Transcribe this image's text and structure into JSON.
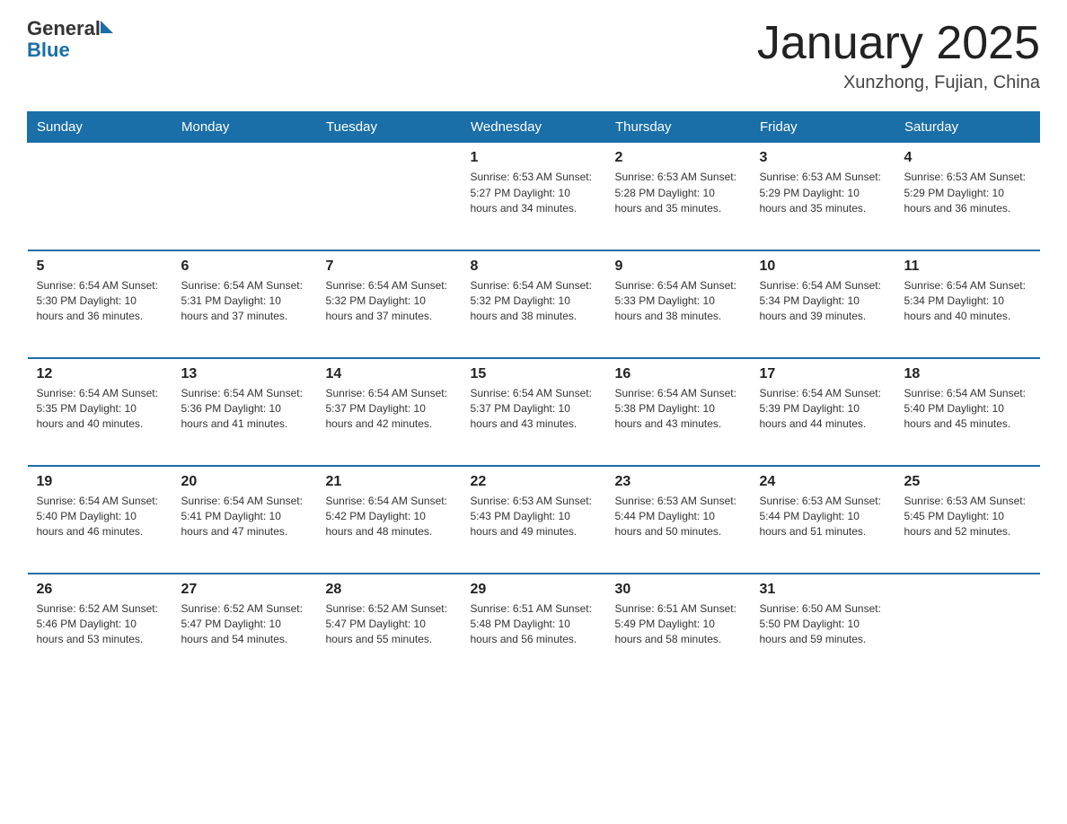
{
  "header": {
    "logo_general": "General",
    "logo_blue": "Blue",
    "title": "January 2025",
    "location": "Xunzhong, Fujian, China"
  },
  "days_of_week": [
    "Sunday",
    "Monday",
    "Tuesday",
    "Wednesday",
    "Thursday",
    "Friday",
    "Saturday"
  ],
  "weeks": [
    {
      "cells": [
        {
          "day": "",
          "info": ""
        },
        {
          "day": "",
          "info": ""
        },
        {
          "day": "",
          "info": ""
        },
        {
          "day": "1",
          "info": "Sunrise: 6:53 AM\nSunset: 5:27 PM\nDaylight: 10 hours\nand 34 minutes."
        },
        {
          "day": "2",
          "info": "Sunrise: 6:53 AM\nSunset: 5:28 PM\nDaylight: 10 hours\nand 35 minutes."
        },
        {
          "day": "3",
          "info": "Sunrise: 6:53 AM\nSunset: 5:29 PM\nDaylight: 10 hours\nand 35 minutes."
        },
        {
          "day": "4",
          "info": "Sunrise: 6:53 AM\nSunset: 5:29 PM\nDaylight: 10 hours\nand 36 minutes."
        }
      ]
    },
    {
      "cells": [
        {
          "day": "5",
          "info": "Sunrise: 6:54 AM\nSunset: 5:30 PM\nDaylight: 10 hours\nand 36 minutes."
        },
        {
          "day": "6",
          "info": "Sunrise: 6:54 AM\nSunset: 5:31 PM\nDaylight: 10 hours\nand 37 minutes."
        },
        {
          "day": "7",
          "info": "Sunrise: 6:54 AM\nSunset: 5:32 PM\nDaylight: 10 hours\nand 37 minutes."
        },
        {
          "day": "8",
          "info": "Sunrise: 6:54 AM\nSunset: 5:32 PM\nDaylight: 10 hours\nand 38 minutes."
        },
        {
          "day": "9",
          "info": "Sunrise: 6:54 AM\nSunset: 5:33 PM\nDaylight: 10 hours\nand 38 minutes."
        },
        {
          "day": "10",
          "info": "Sunrise: 6:54 AM\nSunset: 5:34 PM\nDaylight: 10 hours\nand 39 minutes."
        },
        {
          "day": "11",
          "info": "Sunrise: 6:54 AM\nSunset: 5:34 PM\nDaylight: 10 hours\nand 40 minutes."
        }
      ]
    },
    {
      "cells": [
        {
          "day": "12",
          "info": "Sunrise: 6:54 AM\nSunset: 5:35 PM\nDaylight: 10 hours\nand 40 minutes."
        },
        {
          "day": "13",
          "info": "Sunrise: 6:54 AM\nSunset: 5:36 PM\nDaylight: 10 hours\nand 41 minutes."
        },
        {
          "day": "14",
          "info": "Sunrise: 6:54 AM\nSunset: 5:37 PM\nDaylight: 10 hours\nand 42 minutes."
        },
        {
          "day": "15",
          "info": "Sunrise: 6:54 AM\nSunset: 5:37 PM\nDaylight: 10 hours\nand 43 minutes."
        },
        {
          "day": "16",
          "info": "Sunrise: 6:54 AM\nSunset: 5:38 PM\nDaylight: 10 hours\nand 43 minutes."
        },
        {
          "day": "17",
          "info": "Sunrise: 6:54 AM\nSunset: 5:39 PM\nDaylight: 10 hours\nand 44 minutes."
        },
        {
          "day": "18",
          "info": "Sunrise: 6:54 AM\nSunset: 5:40 PM\nDaylight: 10 hours\nand 45 minutes."
        }
      ]
    },
    {
      "cells": [
        {
          "day": "19",
          "info": "Sunrise: 6:54 AM\nSunset: 5:40 PM\nDaylight: 10 hours\nand 46 minutes."
        },
        {
          "day": "20",
          "info": "Sunrise: 6:54 AM\nSunset: 5:41 PM\nDaylight: 10 hours\nand 47 minutes."
        },
        {
          "day": "21",
          "info": "Sunrise: 6:54 AM\nSunset: 5:42 PM\nDaylight: 10 hours\nand 48 minutes."
        },
        {
          "day": "22",
          "info": "Sunrise: 6:53 AM\nSunset: 5:43 PM\nDaylight: 10 hours\nand 49 minutes."
        },
        {
          "day": "23",
          "info": "Sunrise: 6:53 AM\nSunset: 5:44 PM\nDaylight: 10 hours\nand 50 minutes."
        },
        {
          "day": "24",
          "info": "Sunrise: 6:53 AM\nSunset: 5:44 PM\nDaylight: 10 hours\nand 51 minutes."
        },
        {
          "day": "25",
          "info": "Sunrise: 6:53 AM\nSunset: 5:45 PM\nDaylight: 10 hours\nand 52 minutes."
        }
      ]
    },
    {
      "cells": [
        {
          "day": "26",
          "info": "Sunrise: 6:52 AM\nSunset: 5:46 PM\nDaylight: 10 hours\nand 53 minutes."
        },
        {
          "day": "27",
          "info": "Sunrise: 6:52 AM\nSunset: 5:47 PM\nDaylight: 10 hours\nand 54 minutes."
        },
        {
          "day": "28",
          "info": "Sunrise: 6:52 AM\nSunset: 5:47 PM\nDaylight: 10 hours\nand 55 minutes."
        },
        {
          "day": "29",
          "info": "Sunrise: 6:51 AM\nSunset: 5:48 PM\nDaylight: 10 hours\nand 56 minutes."
        },
        {
          "day": "30",
          "info": "Sunrise: 6:51 AM\nSunset: 5:49 PM\nDaylight: 10 hours\nand 58 minutes."
        },
        {
          "day": "31",
          "info": "Sunrise: 6:50 AM\nSunset: 5:50 PM\nDaylight: 10 hours\nand 59 minutes."
        },
        {
          "day": "",
          "info": ""
        }
      ]
    }
  ]
}
